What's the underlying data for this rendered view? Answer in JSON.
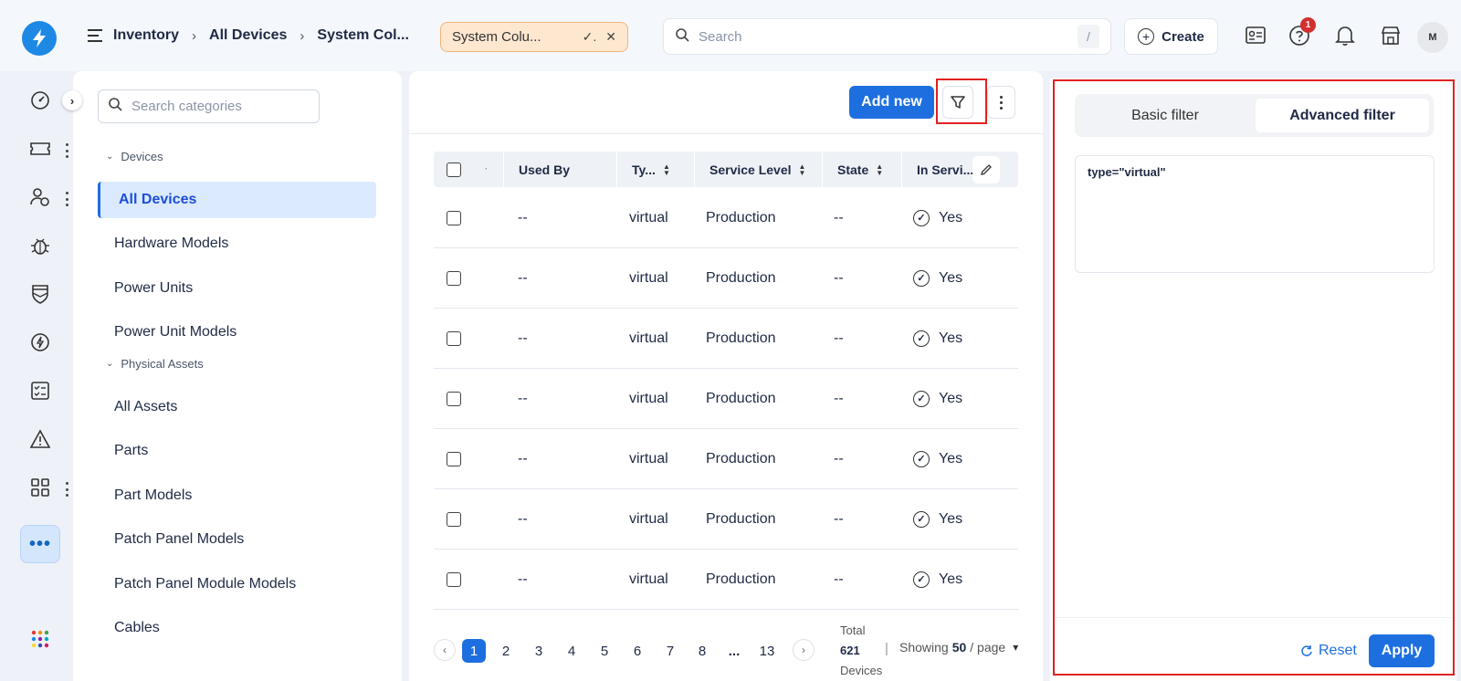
{
  "header": {
    "breadcrumbs": [
      "Inventory",
      "All Devices",
      "System Col..."
    ],
    "view_chip": "System Colu...",
    "search_placeholder": "Search",
    "search_shortcut": "/",
    "create_label": "Create",
    "notification_count": "1",
    "avatar_initial": "M"
  },
  "categories": {
    "search_placeholder": "Search categories",
    "groups": [
      {
        "label": "Devices",
        "items": [
          "All Devices",
          "Hardware Models",
          "Power Units",
          "Power Unit Models"
        ]
      },
      {
        "label": "Physical Assets",
        "items": [
          "All Assets",
          "Parts",
          "Part Models",
          "Patch Panel Models",
          "Patch Panel Module Models",
          "Cables"
        ]
      }
    ],
    "active_item": "All Devices"
  },
  "table": {
    "add_new_label": "Add new",
    "columns": [
      "",
      "Used By",
      "Ty...",
      "Service Level",
      "State",
      "In Servi..."
    ],
    "rows": [
      {
        "used_by": "--",
        "type": "virtual",
        "service_level": "Production",
        "state": "--",
        "in_service": "Yes"
      },
      {
        "used_by": "--",
        "type": "virtual",
        "service_level": "Production",
        "state": "--",
        "in_service": "Yes"
      },
      {
        "used_by": "--",
        "type": "virtual",
        "service_level": "Production",
        "state": "--",
        "in_service": "Yes"
      },
      {
        "used_by": "--",
        "type": "virtual",
        "service_level": "Production",
        "state": "--",
        "in_service": "Yes"
      },
      {
        "used_by": "--",
        "type": "virtual",
        "service_level": "Production",
        "state": "--",
        "in_service": "Yes"
      },
      {
        "used_by": "--",
        "type": "virtual",
        "service_level": "Production",
        "state": "--",
        "in_service": "Yes"
      },
      {
        "used_by": "--",
        "type": "virtual",
        "service_level": "Production",
        "state": "--",
        "in_service": "Yes"
      }
    ]
  },
  "pagination": {
    "pages": [
      "1",
      "2",
      "3",
      "4",
      "5",
      "6",
      "7",
      "8",
      "...",
      "13"
    ],
    "current": "1",
    "total_label": "Total",
    "total_count": "621",
    "total_unit": "Devices",
    "showing_prefix": "Showing",
    "page_size": "50",
    "showing_suffix": "/ page"
  },
  "filter": {
    "tabs": [
      "Basic filter",
      "Advanced filter"
    ],
    "active_tab": "Advanced filter",
    "query": "type=\"virtual\"",
    "reset_label": "Reset",
    "apply_label": "Apply"
  },
  "colors": {
    "primary": "#1d6fe0",
    "highlight_box": "#e12121",
    "chip_bg": "#fde7cf",
    "badge": "#d32f2f"
  }
}
